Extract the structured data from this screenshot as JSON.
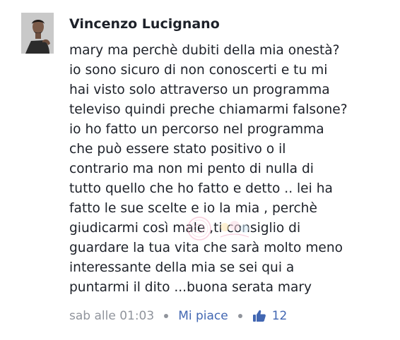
{
  "comment": {
    "author": "Vincenzo Lucignano",
    "lines": [
      "mary ma perchè dubiti della mia onestà?",
      "io sono sicuro di non conoscerti e tu mi",
      "hai visto solo attraverso un programma",
      "televiso quindi preche chiamarmi falsone?",
      "io ho fatto un percorso nel programma",
      "che può essere stato positivo o il",
      "contrario ma non mi pento di nulla di",
      "tutto quello che ho fatto e detto .. lei ha",
      "fatto le sue scelte e io la mia , perchè",
      "giudicarmi così male ,ti consiglio di",
      "guardare la tua vita che sarà molto meno",
      "interessante della mia se sei qui a",
      "puntarmi il dito ...buona serata mary"
    ],
    "timestamp": "sab alle 01:03",
    "like_label": "Mi piace",
    "like_count": "12",
    "like_icon": "thumbs-up-icon",
    "colors": {
      "text": "#1d2129",
      "meta": "#90949c",
      "link": "#4267b2"
    }
  }
}
